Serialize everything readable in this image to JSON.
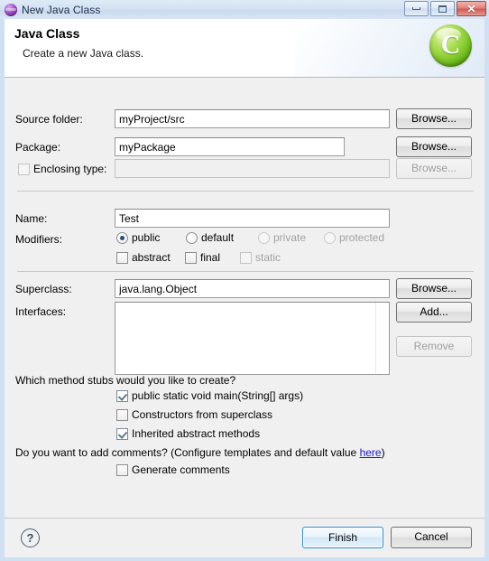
{
  "window": {
    "title": "New Java Class",
    "icon": "eclipse-sphere-icon",
    "controls": {
      "minimize": "–",
      "maximize": "□",
      "close": "✕"
    }
  },
  "header": {
    "title": "Java Class",
    "subtitle": "Create a new Java class.",
    "icon_letter": "C"
  },
  "fields": {
    "source_folder": {
      "label": "Source folder:",
      "value": "myProject/src",
      "button": "Browse..."
    },
    "package": {
      "label": "Package:",
      "value": "myPackage",
      "button": "Browse..."
    },
    "enclosing_type": {
      "label": "Enclosing type:",
      "value": "",
      "button": "Browse...",
      "checked": false,
      "enabled": false
    },
    "name": {
      "label": "Name:",
      "value": "Test"
    },
    "modifiers": {
      "label": "Modifiers:",
      "radios": [
        {
          "label": "public",
          "checked": true,
          "enabled": true
        },
        {
          "label": "default",
          "checked": false,
          "enabled": true
        },
        {
          "label": "private",
          "checked": false,
          "enabled": false
        },
        {
          "label": "protected",
          "checked": false,
          "enabled": false
        }
      ],
      "checkboxes": [
        {
          "label": "abstract",
          "checked": false,
          "enabled": true
        },
        {
          "label": "final",
          "checked": false,
          "enabled": true
        },
        {
          "label": "static",
          "checked": false,
          "enabled": false
        }
      ]
    },
    "superclass": {
      "label": "Superclass:",
      "value": "java.lang.Object",
      "button": "Browse..."
    },
    "interfaces": {
      "label": "Interfaces:",
      "items": [],
      "add_button": "Add...",
      "remove_button": "Remove",
      "remove_enabled": false
    }
  },
  "stubs": {
    "question": "Which method stubs would you like to create?",
    "options": [
      {
        "label": "public static void main(String[] args)",
        "checked": true
      },
      {
        "label": "Constructors from superclass",
        "checked": false
      },
      {
        "label": "Inherited abstract methods",
        "checked": true
      }
    ]
  },
  "comments": {
    "question_prefix": "Do you want to add comments? (Configure templates and default value ",
    "link": "here",
    "question_suffix": ")",
    "option": {
      "label": "Generate comments",
      "checked": false
    }
  },
  "footer": {
    "help": "?",
    "finish": "Finish",
    "cancel": "Cancel"
  }
}
